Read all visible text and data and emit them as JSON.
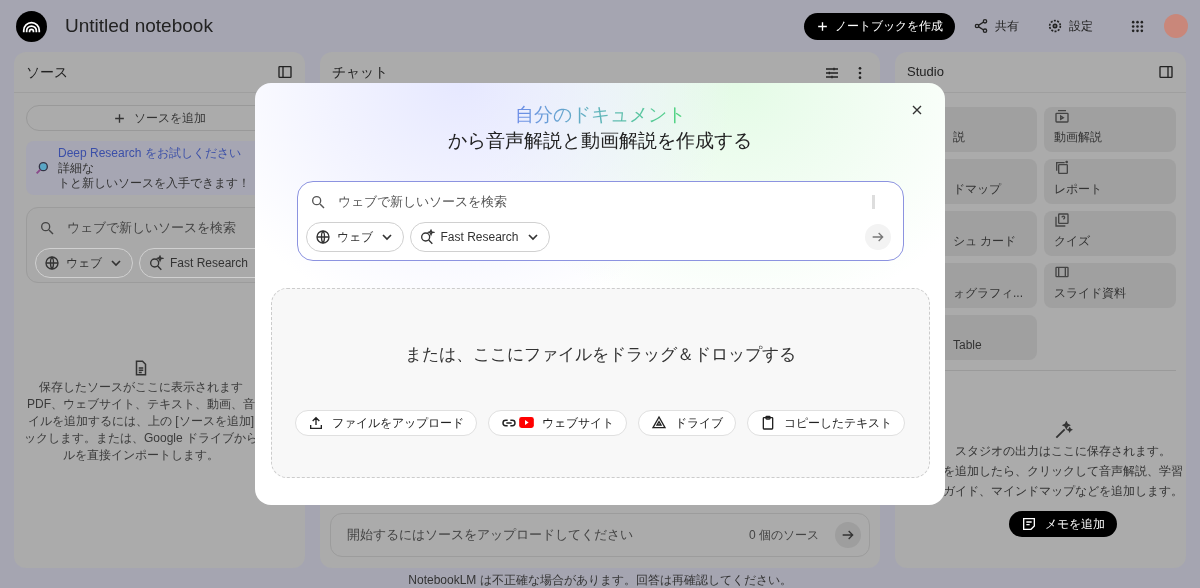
{
  "header": {
    "title": "Untitled notebook",
    "create_button": "ノートブックを作成",
    "share_button": "共有",
    "settings_button": "設定"
  },
  "sources": {
    "title": "ソース",
    "add_button": "ソースを追加",
    "promo": {
      "link": "Deep Research をお試しください",
      "text_line1": "詳細な",
      "text_line2": "トと新しいソースを入手できます！"
    },
    "search": {
      "placeholder": "ウェブで新しいソースを検索",
      "chips": [
        "ウェブ",
        "Fast Research"
      ]
    },
    "empty_lines": [
      "保存したソースがここに表示されます",
      "PDF、ウェブサイト、テキスト、動画、音",
      "イルを追加するには、上の [ソースを追加]",
      "ックします。または、Google ドライブから",
      "ルを直接インポートします。"
    ]
  },
  "chat": {
    "title": "チャット",
    "input_placeholder": "開始するにはソースをアップロードしてください",
    "source_count": "0 個のソース"
  },
  "studio": {
    "title": "Studio",
    "tiles": [
      {
        "label": "説",
        "kind": "covered"
      },
      {
        "label": "動画解説",
        "kind": "video"
      },
      {
        "label": "ドマップ",
        "kind": "covered"
      },
      {
        "label": "レポート",
        "kind": "report"
      },
      {
        "label": "シュ カード",
        "kind": "covered"
      },
      {
        "label": "クイズ",
        "kind": "quiz"
      },
      {
        "label": "ォグラフィ...",
        "kind": "covered"
      },
      {
        "label": "スライド資料",
        "kind": "slides"
      },
      {
        "label": "Table",
        "kind": "covered"
      }
    ],
    "empty_lines": [
      "スタジオの出力はここに保存されます。",
      "を追加したら、クリックして音声解説、学習",
      "ガイド、マインドマップなどを追加します。"
    ],
    "note_button": "メモを追加"
  },
  "footer": "NotebookLM は不正確な場合があります。回答は再確認してください。",
  "modal": {
    "title_highlight": "自分のドキュメント",
    "title_rest": "から音声解説と動画解説を作成する",
    "search": {
      "placeholder": "ウェブで新しいソースを検索",
      "chips": [
        "ウェブ",
        "Fast Research"
      ]
    },
    "drop_text": "または、ここにファイルをドラッグ＆ドロップする",
    "buttons": [
      {
        "label": "ファイルをアップロード",
        "kind": "upload"
      },
      {
        "label": "ウェブサイト",
        "kind": "website"
      },
      {
        "label": "ドライブ",
        "kind": "drive"
      },
      {
        "label": "コピーしたテキスト",
        "kind": "paste"
      }
    ]
  }
}
